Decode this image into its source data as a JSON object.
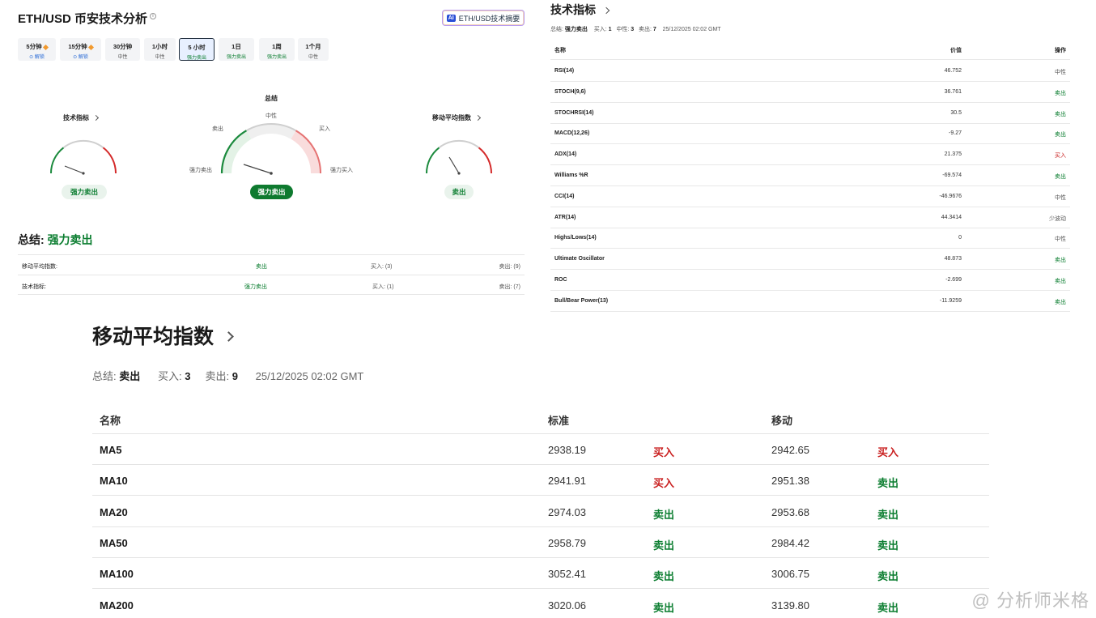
{
  "header": {
    "title": "ETH/USD 币安技术分析",
    "ai_button": "ETH/USD技术摘要",
    "ai_badge": "AI"
  },
  "timeframes": [
    {
      "label": "5分钟",
      "status": "解锁",
      "locked": true
    },
    {
      "label": "15分钟",
      "status": "解锁",
      "locked": true
    },
    {
      "label": "30分钟",
      "status": "中性"
    },
    {
      "label": "1小时",
      "status": "中性"
    },
    {
      "label": "5 小时",
      "status": "强力卖出",
      "active": true
    },
    {
      "label": "1日",
      "status": "强力卖出"
    },
    {
      "label": "1周",
      "status": "强力卖出"
    },
    {
      "label": "1个月",
      "status": "中性"
    }
  ],
  "gauges": {
    "summary_title": "总结",
    "left": {
      "title": "技术指标",
      "result": "强力卖出"
    },
    "center": {
      "result": "强力卖出",
      "labels": {
        "strong_sell": "强力卖出",
        "sell": "卖出",
        "neutral": "中性",
        "buy": "买入",
        "strong_buy": "强力买入"
      }
    },
    "right": {
      "title": "移动平均指数",
      "result": "卖出"
    }
  },
  "summary": {
    "label": "总结:",
    "value": "强力卖出",
    "rows": [
      {
        "name": "移动平均指数:",
        "result": "卖出",
        "buy": "买入: (3)",
        "sell": "卖出: (9)"
      },
      {
        "name": "技术指标:",
        "result": "强力卖出",
        "buy": "买入: (1)",
        "sell": "卖出: (7)"
      }
    ]
  },
  "indicators": {
    "title": "技术指标",
    "meta": {
      "summary_label": "总结:",
      "summary_value": "强力卖出",
      "buy_label": "买入:",
      "buy_value": "1",
      "neutral_label": "中性:",
      "neutral_value": "3",
      "sell_label": "卖出:",
      "sell_value": "7",
      "timestamp": "25/12/2025 02:02 GMT"
    },
    "columns": [
      "名称",
      "价值",
      "操作"
    ],
    "rows": [
      {
        "name": "RSI(14)",
        "value": "46.752",
        "action": "中性"
      },
      {
        "name": "STOCH(9,6)",
        "value": "36.761",
        "action": "卖出"
      },
      {
        "name": "STOCHRSI(14)",
        "value": "30.5",
        "action": "卖出"
      },
      {
        "name": "MACD(12,26)",
        "value": "-9.27",
        "action": "卖出"
      },
      {
        "name": "ADX(14)",
        "value": "21.375",
        "action": "买入"
      },
      {
        "name": "Williams %R",
        "value": "-69.574",
        "action": "卖出"
      },
      {
        "name": "CCI(14)",
        "value": "-46.9676",
        "action": "中性"
      },
      {
        "name": "ATR(14)",
        "value": "44.3414",
        "action": "少波动"
      },
      {
        "name": "Highs/Lows(14)",
        "value": "0",
        "action": "中性"
      },
      {
        "name": "Ultimate Oscillator",
        "value": "48.873",
        "action": "卖出"
      },
      {
        "name": "ROC",
        "value": "-2.699",
        "action": "卖出"
      },
      {
        "name": "Bull/Bear Power(13)",
        "value": "-11.9259",
        "action": "卖出"
      }
    ]
  },
  "moving_averages": {
    "title": "移动平均指数",
    "meta": {
      "summary_label": "总结:",
      "summary_value": "卖出",
      "buy_label": "买入:",
      "buy_value": "3",
      "sell_label": "卖出:",
      "sell_value": "9",
      "timestamp": "25/12/2025 02:02 GMT"
    },
    "columns": [
      "名称",
      "标准",
      "移动"
    ],
    "rows": [
      {
        "name": "MA5",
        "simple": "2938.19",
        "simple_action": "买入",
        "exp": "2942.65",
        "exp_action": "买入"
      },
      {
        "name": "MA10",
        "simple": "2941.91",
        "simple_action": "买入",
        "exp": "2951.38",
        "exp_action": "卖出"
      },
      {
        "name": "MA20",
        "simple": "2974.03",
        "simple_action": "卖出",
        "exp": "2953.68",
        "exp_action": "卖出"
      },
      {
        "name": "MA50",
        "simple": "2958.79",
        "simple_action": "卖出",
        "exp": "2984.42",
        "exp_action": "卖出"
      },
      {
        "name": "MA100",
        "simple": "3052.41",
        "simple_action": "卖出",
        "exp": "3006.75",
        "exp_action": "卖出"
      },
      {
        "name": "MA200",
        "simple": "3020.06",
        "simple_action": "卖出",
        "exp": "3139.80",
        "exp_action": "卖出"
      }
    ]
  },
  "watermark": "@ 分析师米格",
  "colors": {
    "sell": "#0a7d2f",
    "buy": "#c91f1f",
    "neutral": "#555555"
  }
}
